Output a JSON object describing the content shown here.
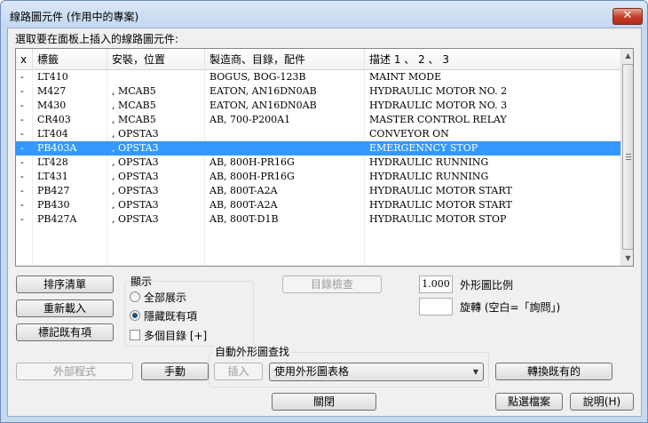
{
  "window": {
    "title": "線路圖元件 (作用中的專案)",
    "close_glyph": "✕"
  },
  "prompt": "選取要在面板上插入的線路圖元件:",
  "list": {
    "columns": [
      "x",
      "標籤",
      "安裝，位置",
      "製造商、目錄，配件",
      "描述 1 、 2 、 3"
    ],
    "rows": [
      [
        "-",
        "LT410",
        "",
        "BOGUS, BOG-123B",
        "MAINT MODE"
      ],
      [
        "-",
        "M427",
        ", MCAB5",
        "EATON, AN16DN0AB",
        "HYDRAULIC MOTOR NO. 2"
      ],
      [
        "-",
        "M430",
        ", MCAB5",
        "EATON, AN16DN0AB",
        "HYDRAULIC MOTOR NO. 3"
      ],
      [
        "-",
        "CR403",
        ", MCAB5",
        "AB, 700-P200A1",
        "MASTER CONTROL RELAY"
      ],
      [
        "-",
        "LT404",
        ", OPSTA3",
        "",
        "CONVEYOR ON"
      ],
      [
        "-",
        "PB403A",
        ", OPSTA3",
        "",
        "EMERGENNCY STOP"
      ],
      [
        "-",
        "LT428",
        ", OPSTA3",
        "AB, 800H-PR16G",
        "HYDRAULIC RUNNING"
      ],
      [
        "-",
        "LT431",
        ", OPSTA3",
        "AB, 800H-PR16G",
        "HYDRAULIC RUNNING"
      ],
      [
        "-",
        "PB427",
        ", OPSTA3",
        "AB, 800T-A2A",
        "HYDRAULIC MOTOR START"
      ],
      [
        "-",
        "PB430",
        ", OPSTA3",
        "AB, 800T-A2A",
        "HYDRAULIC MOTOR START"
      ],
      [
        "-",
        "PB427A",
        ", OPSTA3",
        "AB, 800T-D1B",
        "HYDRAULIC MOTOR STOP"
      ]
    ],
    "selected_index": 5,
    "highlight_color": "#3399ff"
  },
  "buttons": {
    "sort_list": "排序清單",
    "reload": "重新載入",
    "mark_existing": "標記既有項",
    "catalog_check": "目錄檢查",
    "external_program": "外部程式",
    "manual": "手動",
    "insert": "插入",
    "swap_existing": "轉換既有的",
    "pick_file": "點選檔案",
    "close": "關閉",
    "help": "說明(H)"
  },
  "display_group": {
    "label": "顯示",
    "show_all": "全部展示",
    "hide_existing": "隱藏既有項",
    "multi_catalog": "多個目錄 [+]",
    "selected_option": "hide_existing"
  },
  "scale": {
    "value": "1.000",
    "label": "外形圖比例"
  },
  "rotation": {
    "value": "",
    "label": "旋轉 (空白=「詢問」)"
  },
  "auto_lookup": {
    "label": "自動外形圖查找",
    "combo_value": "使用外形圖表格"
  }
}
